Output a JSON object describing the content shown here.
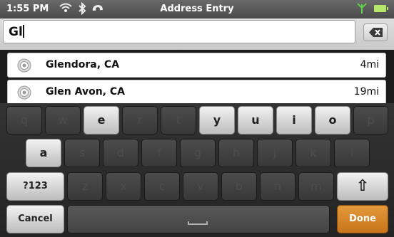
{
  "status_bar": {
    "time": "1:55 PM",
    "title": "Address Entry",
    "icons": [
      "wifi-icon",
      "bluetooth-icon",
      "sync-icon",
      "signal-icon",
      "battery-icon"
    ]
  },
  "search": {
    "value": "Gl"
  },
  "suggestions": [
    {
      "name": "Glendora, CA",
      "distance": "4mi"
    },
    {
      "name": "Glen Avon, CA",
      "distance": "19mi"
    }
  ],
  "keyboard": {
    "row1": [
      "q",
      "w",
      "e",
      "r",
      "t",
      "y",
      "u",
      "i",
      "o",
      "p"
    ],
    "row2": [
      "a",
      "s",
      "d",
      "f",
      "g",
      "h",
      "j",
      "k",
      "l"
    ],
    "row3": [
      "z",
      "x",
      "c",
      "v",
      "b",
      "n",
      "m"
    ],
    "symbols_label": "?123",
    "shift_glyph": "⇧",
    "cancel_label": "Cancel",
    "done_label": "Done",
    "enabled_keys": [
      "e",
      "y",
      "u",
      "i",
      "o",
      "a"
    ]
  },
  "colors": {
    "done_accent": "#d8842a",
    "battery": "#b7e76a",
    "signal": "#5fd24a"
  }
}
